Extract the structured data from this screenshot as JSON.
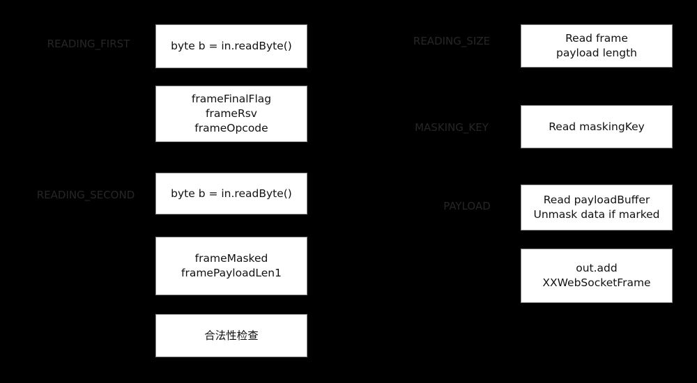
{
  "states": {
    "reading_first": "READING_FIRST",
    "reading_second": "READING_SECOND",
    "reading_size": "READING_SIZE",
    "masking_key": "MASKING_KEY",
    "payload": "PAYLOAD"
  },
  "left_boxes": [
    {
      "lines": [
        "byte b = in.readByte()"
      ]
    },
    {
      "lines": [
        "frameFinalFlag",
        "frameRsv",
        "frameOpcode"
      ]
    },
    {
      "lines": [
        "byte b = in.readByte()"
      ]
    },
    {
      "lines": [
        "frameMasked",
        "framePayloadLen1"
      ]
    },
    {
      "lines": [
        "合法性检查"
      ]
    }
  ],
  "right_boxes": [
    {
      "lines": [
        "Read frame",
        "payload length"
      ]
    },
    {
      "lines": [
        "Read maskingKey"
      ]
    },
    {
      "lines": [
        "Read payloadBuffer",
        "Unmask data if marked"
      ]
    },
    {
      "lines": [
        "out.add",
        "XXWebSocketFrame"
      ]
    }
  ]
}
